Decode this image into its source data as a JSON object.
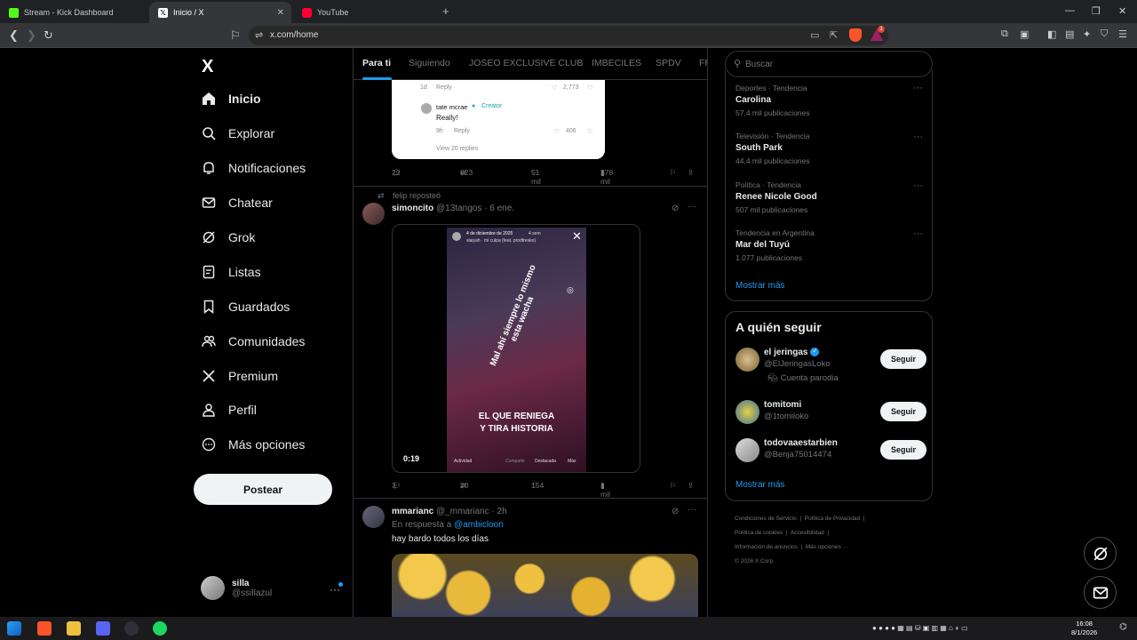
{
  "browser": {
    "tabs": [
      {
        "title": "Stream - Kick Dashboard",
        "color": "#53fc18"
      },
      {
        "title": "Inicio / X",
        "color": "#ffffff"
      },
      {
        "title": "YouTube",
        "color": "#ff0033"
      }
    ],
    "url": "x.com/home",
    "shield_badge": "1"
  },
  "sidebar": {
    "logo": "X",
    "items": [
      {
        "label": "Inicio",
        "icon": "home-icon",
        "bold": true
      },
      {
        "label": "Explorar",
        "icon": "search-icon"
      },
      {
        "label": "Notificaciones",
        "icon": "bell-icon"
      },
      {
        "label": "Chatear",
        "icon": "mail-icon"
      },
      {
        "label": "Grok",
        "icon": "grok-icon"
      },
      {
        "label": "Listas",
        "icon": "list-icon"
      },
      {
        "label": "Guardados",
        "icon": "bookmark-icon"
      },
      {
        "label": "Comunidades",
        "icon": "communities-icon"
      },
      {
        "label": "Premium",
        "icon": "x-icon"
      },
      {
        "label": "Perfil",
        "icon": "person-icon"
      },
      {
        "label": "Más opciones",
        "icon": "more-icon"
      }
    ],
    "post_button": "Postear",
    "account": {
      "name": "silla",
      "handle": "@ssillazul"
    }
  },
  "feed": {
    "tabs": [
      "Para ti",
      "Siguiendo",
      "JOSEO EXCLUSIVE CLUB",
      "IMBECILES",
      "SPDV",
      "FR"
    ],
    "embedded_card": {
      "age1": "1d",
      "reply1": "Reply",
      "likes1": "2,773",
      "reply_name": "tate mcrae",
      "reply_badge": "Creator",
      "reply_text": "Really!",
      "age2": "9h",
      "reply2": "Reply",
      "likes2": "406",
      "view_replies": "View 20 replies"
    },
    "post1_actions": {
      "replies": "22",
      "reposts": "623",
      "likes": "51 mil",
      "views": "378 mil"
    },
    "post2": {
      "reposted_by": "felip reposteó",
      "name": "simoncito",
      "handle": "@13tangos",
      "date": "6 ene.",
      "video": {
        "date_line": "4 de diciembre de 2025",
        "age": "4 sem",
        "song": "slaiyah · mi culpa (feat. prodfresko)",
        "overlay_line1": "EL QUE RENIEGA",
        "overlay_line2": "Y TIRA HISTORIA",
        "rotated_text": "Mal ahí siempre lo mismo esta wacha",
        "bottom": [
          "Actividad",
          "Compartir",
          "Destacada",
          "Más"
        ],
        "timer": "0:19"
      },
      "actions": {
        "replies": "3",
        "reposts": "20",
        "likes": "154",
        "views": "1 mil"
      }
    },
    "post3": {
      "name": "mmarianc",
      "handle": "@_mmarianc",
      "age": "2h",
      "reply_to_prefix": "En respuesta a",
      "reply_to": "@ambicloon",
      "text": "hay bardo todos los días"
    }
  },
  "right": {
    "search_placeholder": "Buscar",
    "trends": [
      {
        "category": "Deportes · Tendencia",
        "name": "Carolina",
        "count": "57,4 mil publicaciones"
      },
      {
        "category": "Televisión · Tendencia",
        "name": "South Park",
        "count": "44,4 mil publicaciones"
      },
      {
        "category": "Política · Tendencia",
        "name": "Renee Nicole Good",
        "count": "507 mil publicaciones"
      },
      {
        "category": "Tendencia en Argentina",
        "name": "Mar del Tuyú",
        "count": "1.077 publicaciones"
      }
    ],
    "show_more": "Mostrar más",
    "who_to_follow": {
      "title": "A quién seguir",
      "users": [
        {
          "name": "el jeringas",
          "handle": "@ElJeringasLoko",
          "note": "Cuenta parodia",
          "button": "Seguir",
          "verified": true
        },
        {
          "name": "tomitomi",
          "handle": "@1tomiloko",
          "button": "Seguir"
        },
        {
          "name": "todovaaestarbien",
          "handle": "@Benja75014474",
          "button": "Seguir"
        }
      ],
      "show_more": "Mostrar más"
    },
    "footer": [
      "Condiciones de Servicio",
      "Política de Privacidad",
      "Política de cookies",
      "Accesibilidad",
      "Información de anuncios",
      "Más opciones ···",
      "© 2026 X Corp."
    ]
  },
  "taskbar": {
    "time": "16:08",
    "date": "8/1/2026"
  }
}
